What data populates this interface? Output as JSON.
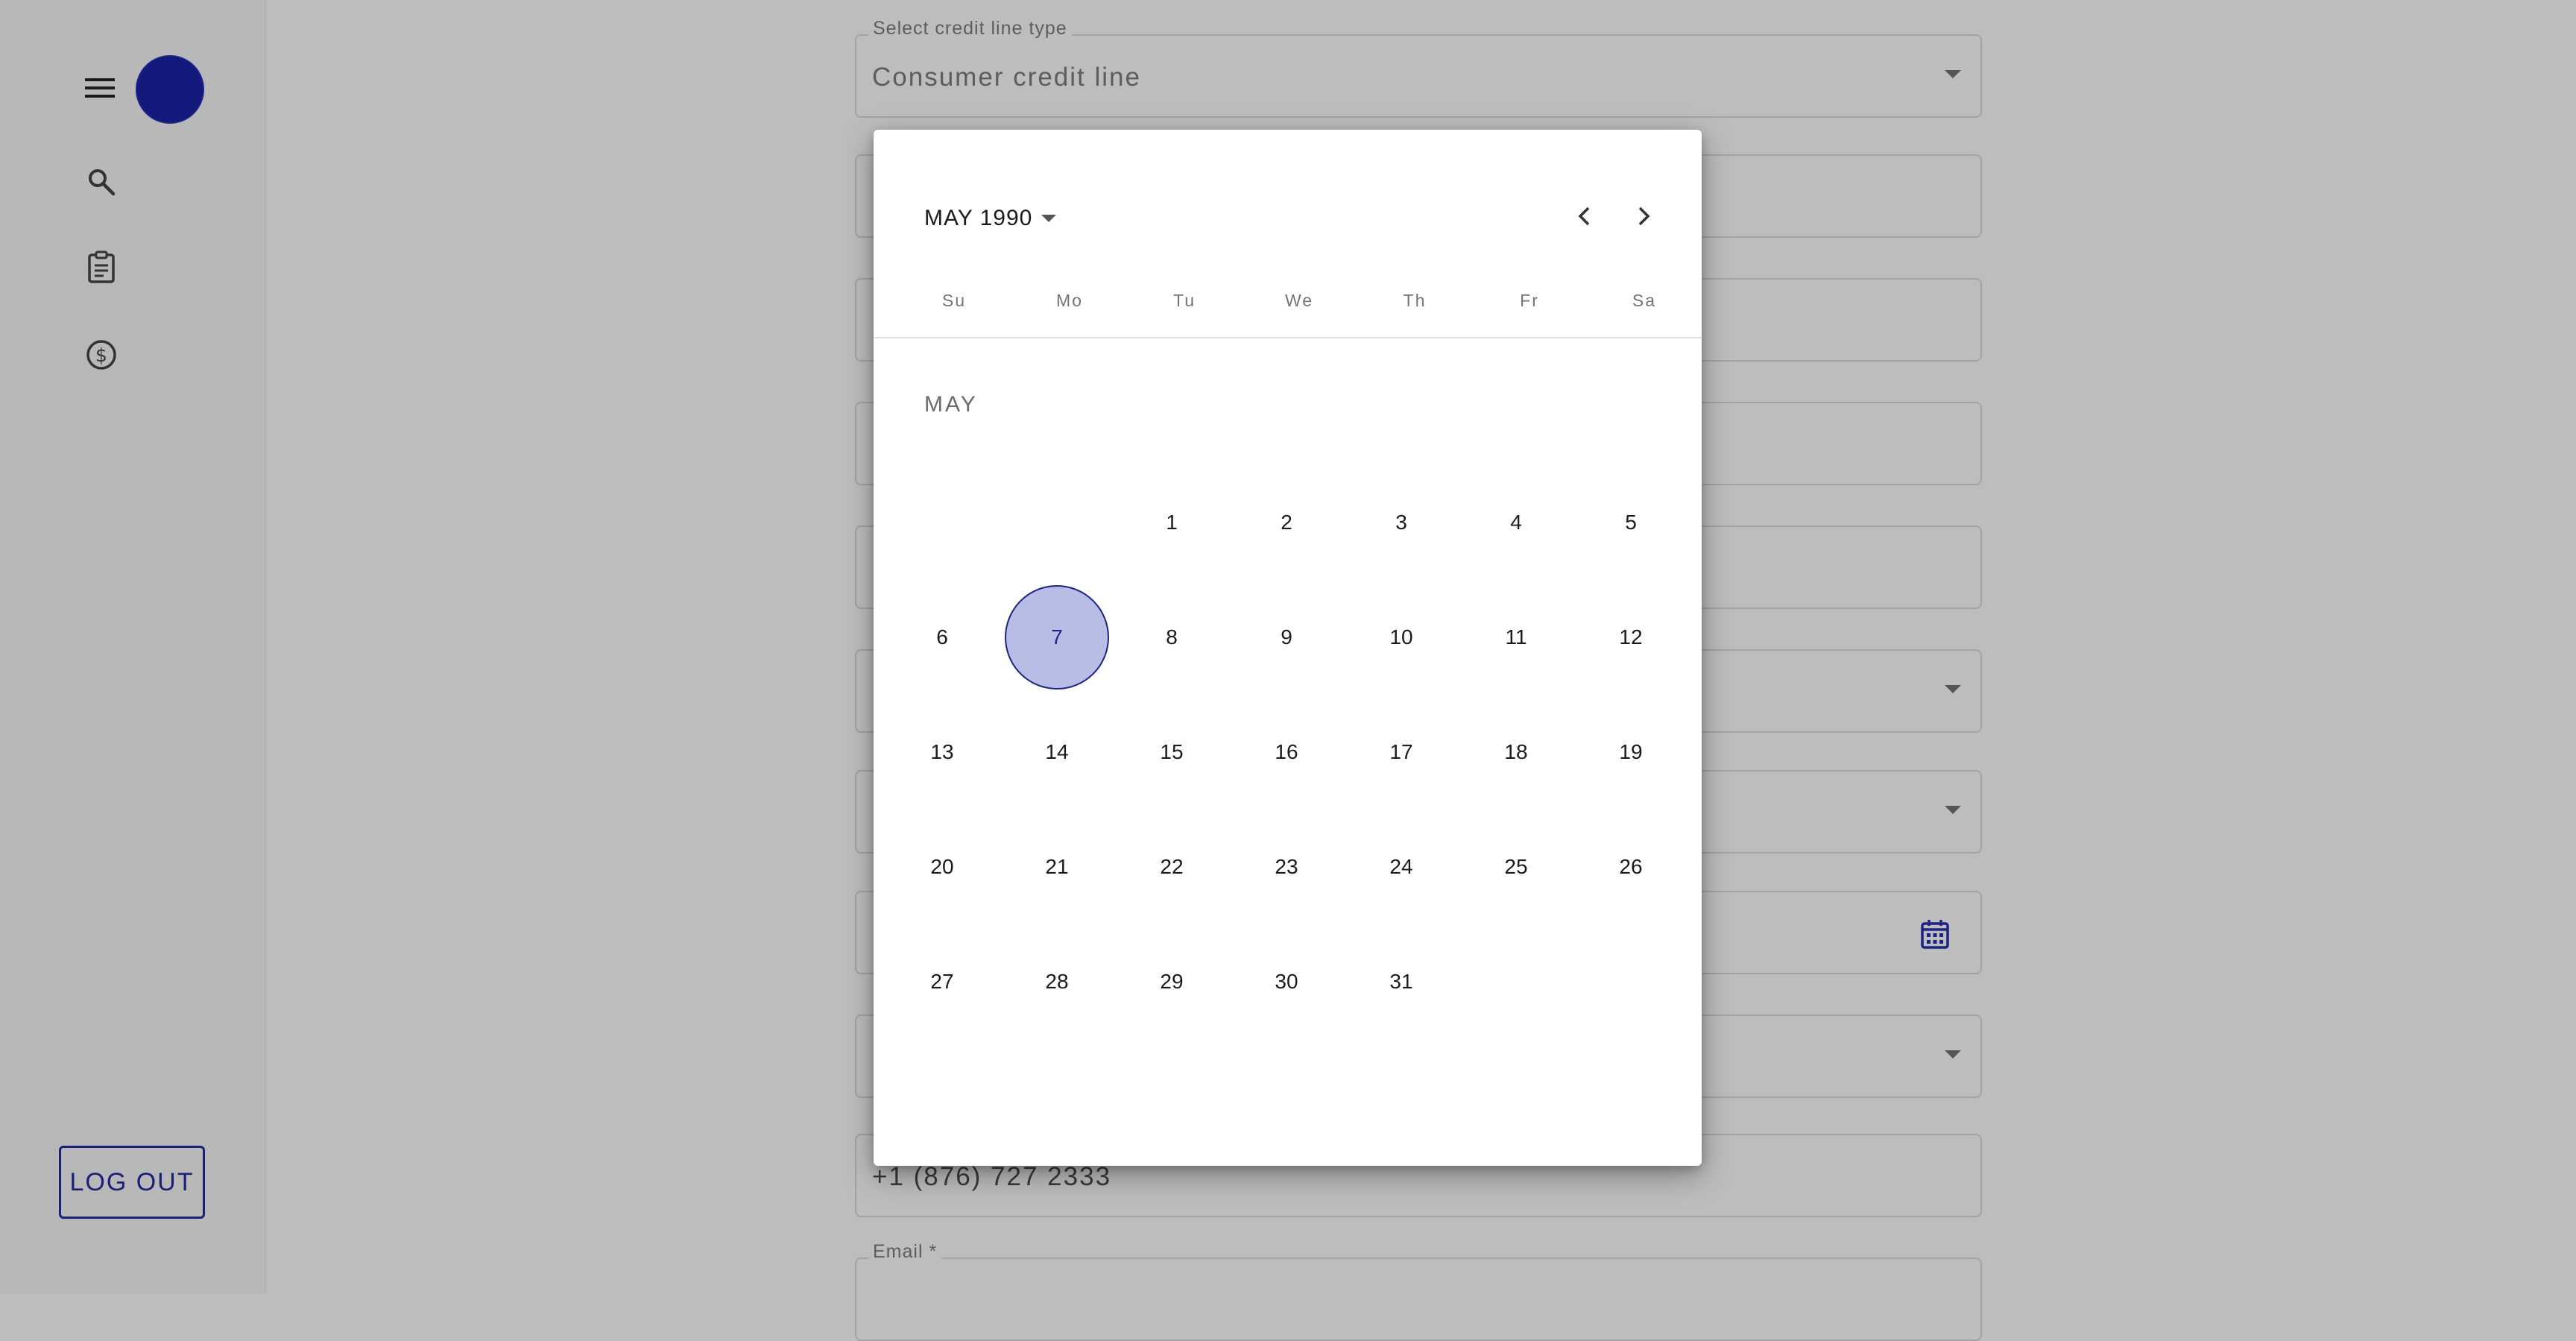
{
  "sidebar": {
    "logout_label": "LOG OUT",
    "avatar_color": "#13197a"
  },
  "form": {
    "fields": [
      {
        "label": "Select credit line type",
        "value": "Consumer credit line"
      },
      {
        "label": "",
        "value": ""
      },
      {
        "label": "",
        "value": ""
      },
      {
        "label": "",
        "value": ""
      },
      {
        "label": "",
        "value": ""
      },
      {
        "label": "",
        "value": ""
      },
      {
        "label": "",
        "value": ""
      },
      {
        "label": "",
        "value": ""
      },
      {
        "label": "",
        "value": ""
      },
      {
        "label": "",
        "value": "+1 (876) 727 2333"
      },
      {
        "label": "Email *",
        "value": ""
      }
    ]
  },
  "datepicker": {
    "month_year": "MAY 1990",
    "month_label": "MAY",
    "weekdays": [
      "Su",
      "Mo",
      "Tu",
      "We",
      "Th",
      "Fr",
      "Sa"
    ],
    "days": [
      "1",
      "2",
      "3",
      "4",
      "5",
      "6",
      "7",
      "8",
      "9",
      "10",
      "11",
      "12",
      "13",
      "14",
      "15",
      "16",
      "17",
      "18",
      "19",
      "20",
      "21",
      "22",
      "23",
      "24",
      "25",
      "26",
      "27",
      "28",
      "29",
      "30",
      "31"
    ],
    "selected_day": "7",
    "accent_color": "#1d2384"
  }
}
